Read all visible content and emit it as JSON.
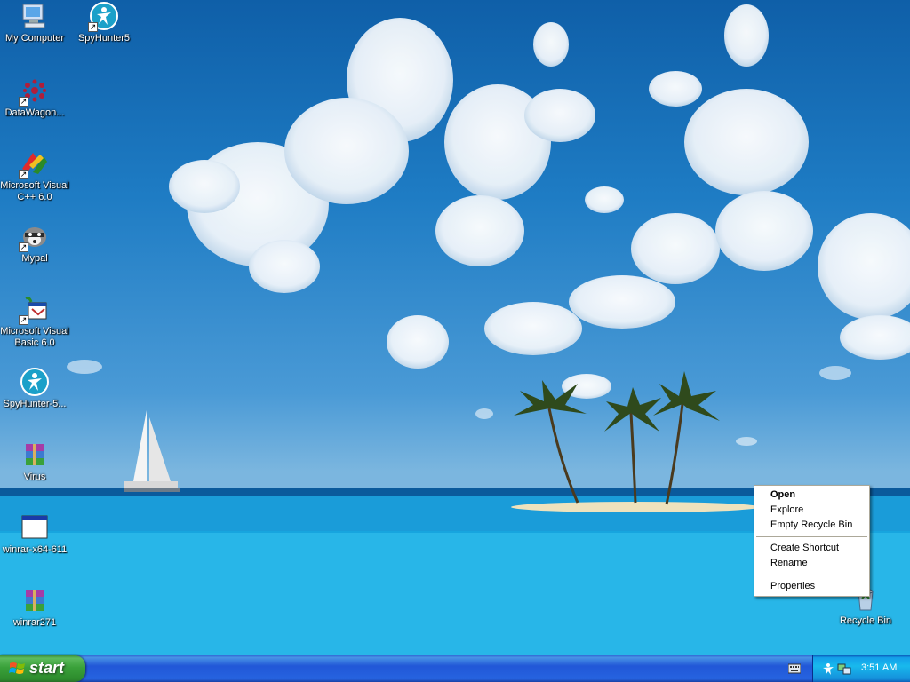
{
  "desktop": {
    "icons": [
      {
        "id": "my-computer",
        "label": "My Computer",
        "icon": "computer-icon"
      },
      {
        "id": "spyhunter5",
        "label": "SpyHunter5",
        "icon": "spyhunter-icon"
      },
      {
        "id": "datawagon",
        "label": "DataWagon...",
        "icon": "datawagon-icon"
      },
      {
        "id": "ms-visual-cpp",
        "label": "Microsoft Visual\nC++ 6.0",
        "icon": "visual-cpp-icon"
      },
      {
        "id": "mypal",
        "label": "Mypal",
        "icon": "mypal-raccoon-icon"
      },
      {
        "id": "ms-visual-basic",
        "label": "Microsoft Visual\nBasic 6.0",
        "icon": "visual-basic-icon"
      },
      {
        "id": "spyhunter-5-installer",
        "label": "SpyHunter-5...",
        "icon": "spyhunter-icon"
      },
      {
        "id": "virus",
        "label": "Virus",
        "icon": "winrar-archive-icon"
      },
      {
        "id": "winrar-x64-611",
        "label": "winrar-x64-611",
        "icon": "application-window-icon"
      },
      {
        "id": "winrar271",
        "label": "winrar271",
        "icon": "winrar-archive-icon"
      },
      {
        "id": "recycle-bin",
        "label": "Recycle Bin",
        "icon": "recycle-bin-icon"
      }
    ]
  },
  "context_menu": {
    "items": [
      {
        "label": "Open",
        "default": true
      },
      {
        "label": "Explore"
      },
      {
        "label": "Empty Recycle Bin"
      },
      {
        "separator": true
      },
      {
        "label": "Create Shortcut"
      },
      {
        "label": "Rename"
      },
      {
        "separator": true
      },
      {
        "label": "Properties"
      }
    ]
  },
  "taskbar": {
    "start_label": "start",
    "clock": "3:51 AM",
    "tray_icons": [
      "spyhunter-icon",
      "network-icon"
    ],
    "quick_icon": "keyboard-icon"
  },
  "colors": {
    "taskbar_blue": "#2157d7",
    "start_green": "#3aa13a",
    "tray_blue": "#139ee9"
  }
}
